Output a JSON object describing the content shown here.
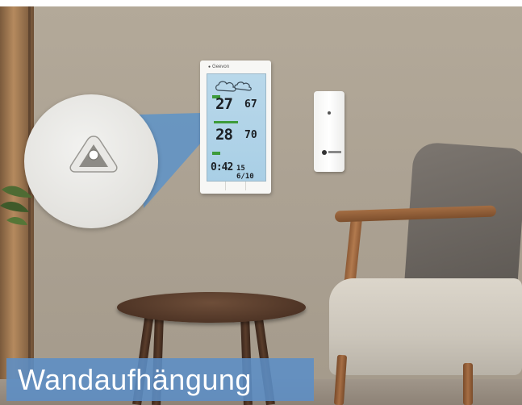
{
  "caption": {
    "text": "Wandaufhängung"
  },
  "station": {
    "brand": "Geevon",
    "indoor_temperature": "27",
    "indoor_humidity": "67",
    "outdoor_temperature": "28",
    "outdoor_humidity": "70",
    "time": "0:42",
    "date": "15 6/10"
  },
  "colors": {
    "wall": "#aca293",
    "caption_background": "#5c8ec6",
    "lcd_background": "#b2d4e8",
    "table_wood": "#5a3d2b",
    "armchair_fabric": "#d6d0c5",
    "cushion": "#6e6964"
  }
}
